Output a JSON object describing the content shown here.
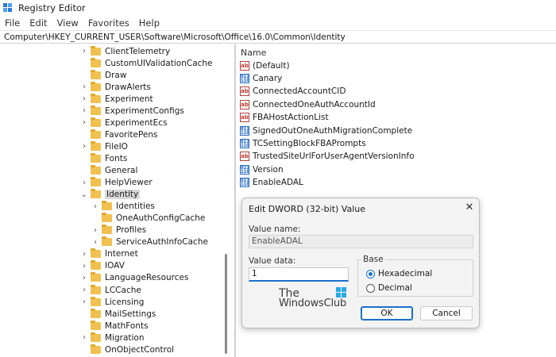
{
  "window": {
    "title": "Registry Editor",
    "accent": "#2b79d6"
  },
  "menu": [
    "File",
    "Edit",
    "View",
    "Favorites",
    "Help"
  ],
  "address": "Computer\\HKEY_CURRENT_USER\\Software\\Microsoft\\Office\\16.0\\Common\\Identity",
  "tree": [
    {
      "label": "ClientTelemetry",
      "chevron": "›",
      "level": 0
    },
    {
      "label": "CustomUIValidationCache",
      "chevron": "",
      "level": 0
    },
    {
      "label": "Draw",
      "chevron": "",
      "level": 0
    },
    {
      "label": "DrawAlerts",
      "chevron": "›",
      "level": 0
    },
    {
      "label": "Experiment",
      "chevron": "›",
      "level": 0
    },
    {
      "label": "ExperimentConfigs",
      "chevron": "›",
      "level": 0
    },
    {
      "label": "ExperimentEcs",
      "chevron": "›",
      "level": 0
    },
    {
      "label": "FavoritePens",
      "chevron": "",
      "level": 0
    },
    {
      "label": "FileIO",
      "chevron": "›",
      "level": 0
    },
    {
      "label": "Fonts",
      "chevron": "",
      "level": 0
    },
    {
      "label": "General",
      "chevron": "",
      "level": 0
    },
    {
      "label": "HelpViewer",
      "chevron": "›",
      "level": 0
    },
    {
      "label": "Identity",
      "chevron": "⌄",
      "level": 0,
      "selected": true
    },
    {
      "label": "Identities",
      "chevron": "›",
      "level": 1
    },
    {
      "label": "OneAuthConfigCache",
      "chevron": "",
      "level": 1
    },
    {
      "label": "Profiles",
      "chevron": "›",
      "level": 1
    },
    {
      "label": "ServiceAuthInfoCache",
      "chevron": "›",
      "level": 1
    },
    {
      "label": "Internet",
      "chevron": "›",
      "level": 0
    },
    {
      "label": "IOAV",
      "chevron": "›",
      "level": 0
    },
    {
      "label": "LanguageResources",
      "chevron": "›",
      "level": 0
    },
    {
      "label": "LCCache",
      "chevron": "›",
      "level": 0
    },
    {
      "label": "Licensing",
      "chevron": "›",
      "level": 0
    },
    {
      "label": "MailSettings",
      "chevron": "",
      "level": 0
    },
    {
      "label": "MathFonts",
      "chevron": "",
      "level": 0
    },
    {
      "label": "Migration",
      "chevron": "›",
      "level": 0
    },
    {
      "label": "OnObjectControl",
      "chevron": "",
      "level": 0
    }
  ],
  "values_header": "Name",
  "values": [
    {
      "name": "(Default)",
      "icon": "string-value-icon",
      "glyph": "ab"
    },
    {
      "name": "Canary",
      "icon": "binary-value-icon",
      "glyph": "011 110"
    },
    {
      "name": "ConnectedAccountCID",
      "icon": "string-value-icon",
      "glyph": "ab"
    },
    {
      "name": "ConnectedOneAuthAccountId",
      "icon": "string-value-icon",
      "glyph": "ab"
    },
    {
      "name": "FBAHostActionList",
      "icon": "string-value-icon",
      "glyph": "ab"
    },
    {
      "name": "SignedOutOneAuthMigrationComplete",
      "icon": "binary-value-icon",
      "glyph": "011 110"
    },
    {
      "name": "TCSettingBlockFBAPrompts",
      "icon": "binary-value-icon",
      "glyph": "011 110"
    },
    {
      "name": "TrustedSiteUrlForUserAgentVersionInfo",
      "icon": "string-value-icon",
      "glyph": "ab"
    },
    {
      "name": "Version",
      "icon": "binary-value-icon",
      "glyph": "011 110"
    },
    {
      "name": "EnableADAL",
      "icon": "binary-value-icon",
      "glyph": "011 110"
    }
  ],
  "dialog": {
    "title": "Edit DWORD (32-bit) Value",
    "close_glyph": "✕",
    "value_name_label": "Value name:",
    "value_name": "EnableADAL",
    "value_data_label": "Value data:",
    "value_data": "1",
    "base_label": "Base",
    "radio_hex": "Hexadecimal",
    "radio_dec": "Decimal",
    "base_selected": "hex",
    "ok_label": "OK",
    "cancel_label": "Cancel",
    "focus_color": "#1c6fcb"
  },
  "watermark": {
    "line1": "The",
    "line2": "WindowsClub"
  }
}
